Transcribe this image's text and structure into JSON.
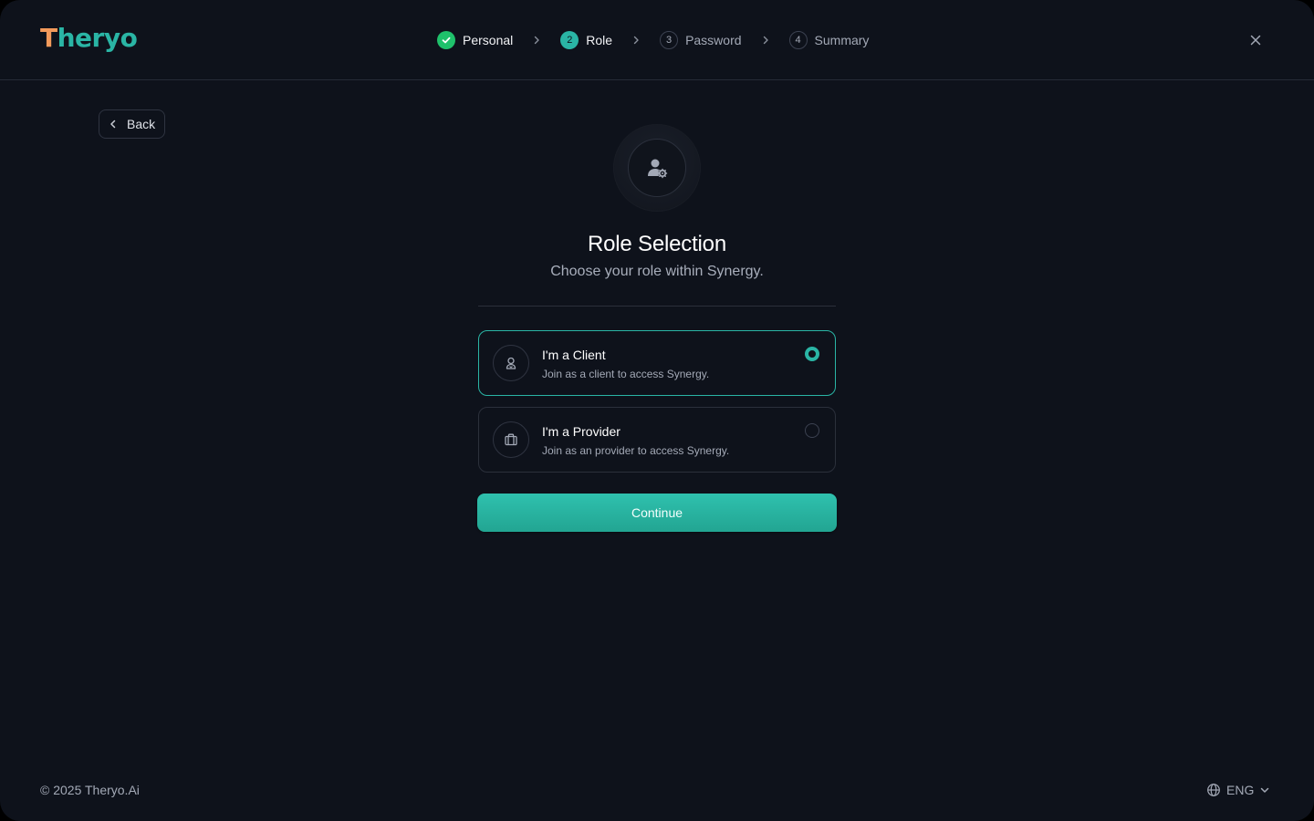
{
  "app": {
    "name": "Theryo",
    "logo_first": "T",
    "logo_rest": "heryo"
  },
  "stepper": {
    "steps": [
      {
        "number": "",
        "label": "Personal",
        "state": "done"
      },
      {
        "number": "2",
        "label": "Role",
        "state": "active"
      },
      {
        "number": "3",
        "label": "Password",
        "state": "pending"
      },
      {
        "number": "4",
        "label": "Summary",
        "state": "pending"
      }
    ]
  },
  "back_label": "Back",
  "role": {
    "title": "Role Selection",
    "subtitle": "Choose your role within Synergy.",
    "options": [
      {
        "title": "I'm a Client",
        "desc": "Join as a client to access Synergy.",
        "selected": true,
        "icon": "user-icon"
      },
      {
        "title": "I'm a Provider",
        "desc": "Join as an provider to access Synergy.",
        "selected": false,
        "icon": "briefcase-icon"
      }
    ],
    "continue_label": "Continue"
  },
  "footer": {
    "copyright": "© 2025 Theryo.Ai",
    "language": "ENG"
  },
  "colors": {
    "background": "#0e121b",
    "accent": "#2ab5a5",
    "success": "#1fc16b",
    "logo_orange": "#f39a5b"
  }
}
